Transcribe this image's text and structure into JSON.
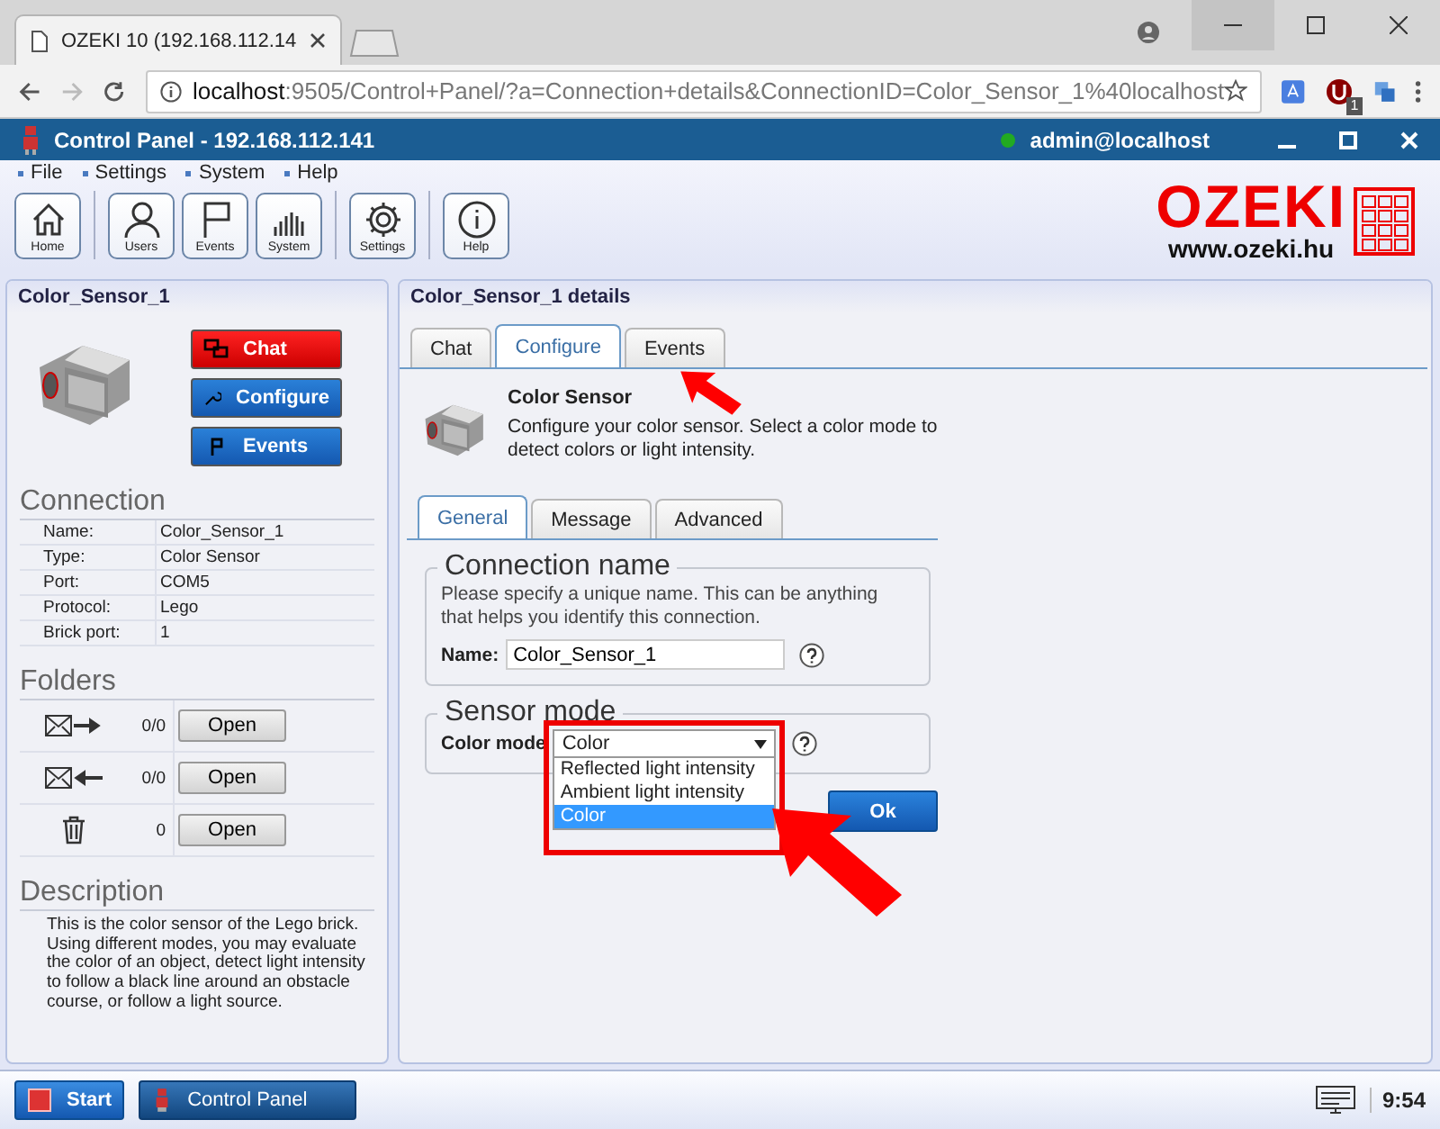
{
  "browser": {
    "tab_title": "OZEKI 10 (192.168.112.14",
    "url_host": "localhost",
    "url_rest": ":9505/Control+Panel/?a=Connection+details&ConnectionID=Color_Sensor_1%40localhost",
    "ext_badge": "1"
  },
  "app": {
    "title": "Control Panel",
    "address": "- 192.168.112.141",
    "user": "admin@localhost",
    "online": true
  },
  "menu": [
    "File",
    "Settings",
    "System",
    "Help"
  ],
  "toolbar": [
    [
      {
        "label": "Home",
        "kind": "home"
      }
    ],
    [
      {
        "label": "Users",
        "kind": "user"
      },
      {
        "label": "Events",
        "kind": "flag"
      },
      {
        "label": "System",
        "kind": "bars"
      }
    ],
    [
      {
        "label": "Settings",
        "kind": "gear"
      }
    ],
    [
      {
        "label": "Help",
        "kind": "info"
      }
    ]
  ],
  "logo": {
    "name": "OZEKI",
    "url": "www.ozeki.hu"
  },
  "left": {
    "title": "Color_Sensor_1",
    "buttons": [
      {
        "label": "Chat",
        "kind": "chat"
      },
      {
        "label": "Configure",
        "kind": "configure"
      },
      {
        "label": "Events",
        "kind": "events"
      }
    ],
    "connection": {
      "heading": "Connection",
      "rows": [
        {
          "label": "Name:",
          "value": "Color_Sensor_1"
        },
        {
          "label": "Type:",
          "value": "Color Sensor"
        },
        {
          "label": "Port:",
          "value": "COM5"
        },
        {
          "label": "Protocol:",
          "value": "Lego"
        },
        {
          "label": "Brick port:",
          "value": "1"
        }
      ]
    },
    "folders": {
      "heading": "Folders",
      "rows": [
        {
          "kind": "outbox",
          "count": "0/0",
          "button": "Open"
        },
        {
          "kind": "inbox",
          "count": "0/0",
          "button": "Open"
        },
        {
          "kind": "trash",
          "count": "0",
          "button": "Open"
        }
      ]
    },
    "description": {
      "heading": "Description",
      "text": "This is the color sensor of the Lego brick. Using different modes, you may evaluate the color of an object, detect light intensity to follow a black line around an obstacle course, or follow a light source."
    }
  },
  "right": {
    "title": "Color_Sensor_1 details",
    "tabs": [
      {
        "label": "Chat",
        "selected": false
      },
      {
        "label": "Configure",
        "selected": true
      },
      {
        "label": "Events",
        "selected": false
      }
    ],
    "info": {
      "title": "Color Sensor",
      "text": "Configure your color sensor. Select a color mode to detect colors or light intensity."
    },
    "subtabs": [
      {
        "label": "General",
        "selected": true
      },
      {
        "label": "Message",
        "selected": false
      },
      {
        "label": "Advanced",
        "selected": false
      }
    ],
    "connection_name": {
      "legend": "Connection name",
      "hint": "Please specify a unique name. This can be anything that helps you identify this connection.",
      "label": "Name:",
      "value": "Color_Sensor_1"
    },
    "sensor_mode": {
      "legend": "Sensor mode",
      "label": "Color mode",
      "value": "Color",
      "expanded": true,
      "options": [
        {
          "label": "Reflected light intensity",
          "selected": false
        },
        {
          "label": "Ambient light intensity",
          "selected": false
        },
        {
          "label": "Color",
          "selected": true
        }
      ]
    },
    "ok": "Ok"
  },
  "taskbar": {
    "start": "Start",
    "app": "Control Panel",
    "clock": "9:54"
  }
}
